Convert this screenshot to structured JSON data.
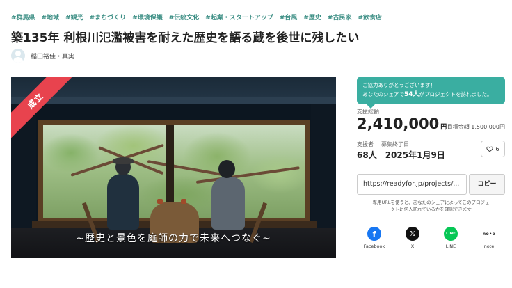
{
  "tags": [
    "#群馬県",
    "#地域",
    "#観光",
    "#まちづくり",
    "#環境保護",
    "#伝統文化",
    "#起業・スタートアップ",
    "#台風",
    "#歴史",
    "#古民家",
    "#飲食店"
  ],
  "title": "築135年 利根川氾濫被害を耐えた歴史を語る蔵を後世に残したい",
  "author": {
    "name": "稲田裕佳・真実"
  },
  "hero": {
    "badge": "成立",
    "caption": "~歴史と景色を庭師の力で未来へつなぐ~"
  },
  "thanks": {
    "line1": "ご協力ありがとうございます！",
    "line2_prefix": "あなたのシェアで",
    "line2_count": "54人",
    "line2_suffix": "がプロジェクトを訪れました。"
  },
  "funding": {
    "total_label": "支援総額",
    "total_amount": "2,410,000",
    "currency": "円",
    "goal_label": "目標金額",
    "goal_amount": "1,500,000円",
    "supporters_label": "支援者",
    "supporters_value": "68人",
    "deadline_label": "募集終了日",
    "deadline_value": "2025年1月9日",
    "likes": "6"
  },
  "share": {
    "url": "https://readyfor.jp/projects/...",
    "copy_label": "コピー",
    "note_line1": "専用URLを使うと、あなたのシェアによってこのプロジェ",
    "note_line2": "クトに何人訪れているかを確認できます",
    "buttons": [
      {
        "label": "Facebook",
        "icon": "facebook-icon"
      },
      {
        "label": "X",
        "icon": "x-icon"
      },
      {
        "label": "LINE",
        "icon": "line-icon"
      },
      {
        "label": "note",
        "icon": "note-icon"
      }
    ]
  },
  "colors": {
    "tag": "#3d8f85",
    "accent": "#3aaea1",
    "ribbon": "#e8434e"
  }
}
